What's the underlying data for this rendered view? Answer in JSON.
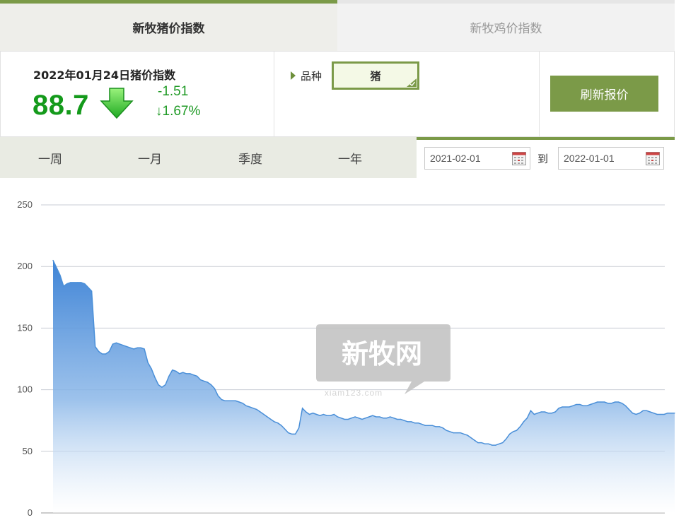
{
  "tabs": [
    {
      "label": "新牧猪价指数",
      "active": true
    },
    {
      "label": "新牧鸡价指数",
      "active": false
    }
  ],
  "index": {
    "title": "2022年01月24日猪价指数",
    "value": "88.7",
    "change": "-1.51",
    "change_pct": "↓1.67%",
    "trend_icon": "down-arrow-icon"
  },
  "variety": {
    "label": "品种",
    "selected": "猪"
  },
  "refresh_label": "刷新报价",
  "periods": [
    "一周",
    "一月",
    "季度",
    "一年"
  ],
  "date_range": {
    "start": "2021-02-01",
    "separator": "到",
    "end": "2022-01-01"
  },
  "watermark": {
    "logo_text": "新牧网",
    "url_text": "xiam123.com"
  },
  "colors": {
    "accent": "#7b9a48",
    "value_green": "#149a1b",
    "line_blue": "#4a8fd8"
  },
  "chart_data": {
    "type": "area",
    "title": "",
    "xlabel": "",
    "ylabel": "",
    "ylim": [
      0,
      250
    ],
    "yticks": [
      0,
      50,
      100,
      150,
      200,
      250
    ],
    "grid": true,
    "legend": "none",
    "x_range": [
      "2021-02-01",
      "2022-01-01"
    ],
    "series": [
      {
        "values": [
          205,
          199,
          193,
          184,
          186,
          187,
          187,
          187,
          187,
          186,
          183,
          180,
          135,
          131,
          129,
          129,
          131,
          137,
          138,
          137,
          136,
          135,
          134,
          133,
          134,
          134,
          133,
          122,
          117,
          110,
          104,
          102,
          104,
          111,
          116,
          115,
          113,
          114,
          113,
          113,
          112,
          111,
          108,
          107,
          106,
          104,
          101,
          95,
          92,
          91,
          91,
          91,
          91,
          90,
          89,
          87,
          86,
          85,
          84,
          82,
          80,
          78,
          76,
          74,
          73,
          71,
          68,
          65,
          64,
          64,
          69,
          85,
          82,
          80,
          81,
          80,
          79,
          80,
          79,
          79,
          80,
          78,
          77,
          76,
          76,
          77,
          78,
          77,
          76,
          77,
          78,
          79,
          78,
          78,
          77,
          77,
          78,
          77,
          76,
          76,
          75,
          74,
          74,
          73,
          73,
          72,
          71,
          71,
          71,
          70,
          70,
          69,
          67,
          66,
          65,
          65,
          65,
          64,
          63,
          61,
          59,
          57,
          57,
          56,
          56,
          55,
          55,
          56,
          57,
          60,
          64,
          66,
          67,
          70,
          74,
          77,
          83,
          80,
          81,
          82,
          82,
          81,
          81,
          82,
          85,
          86,
          86,
          86,
          87,
          88,
          88,
          87,
          87,
          88,
          89,
          90,
          90,
          90,
          89,
          89,
          90,
          90,
          89,
          87,
          84,
          81,
          80,
          81,
          83,
          83,
          82,
          81,
          80,
          80,
          80,
          81,
          81,
          81
        ]
      }
    ]
  }
}
